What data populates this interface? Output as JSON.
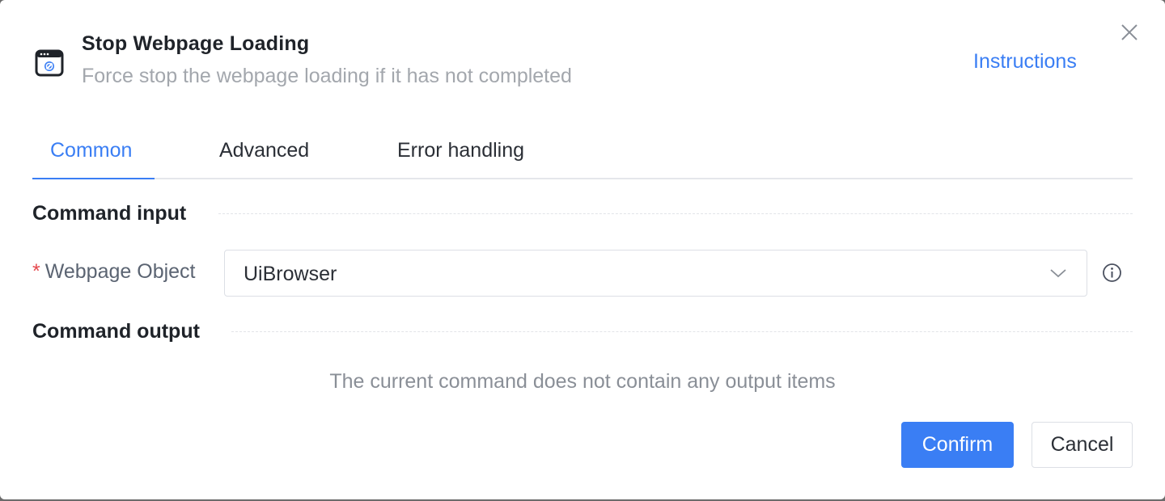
{
  "dialog": {
    "title": "Stop Webpage Loading",
    "subtitle": "Force stop the webpage loading if it has not completed",
    "instructions_link": "Instructions",
    "icon": "browser-stop-icon"
  },
  "tabs": [
    {
      "label": "Common",
      "active": true
    },
    {
      "label": "Advanced",
      "active": false
    },
    {
      "label": "Error handling",
      "active": false
    }
  ],
  "sections": {
    "input_title": "Command input",
    "output_title": "Command output"
  },
  "fields": {
    "webpage_object": {
      "required_mark": "*",
      "label": "Webpage Object",
      "value": "UiBrowser"
    }
  },
  "output": {
    "empty_message": "The current command does not contain any output items"
  },
  "buttons": {
    "confirm": "Confirm",
    "cancel": "Cancel"
  },
  "colors": {
    "accent": "#3a7ef4",
    "required": "#e5484d"
  }
}
